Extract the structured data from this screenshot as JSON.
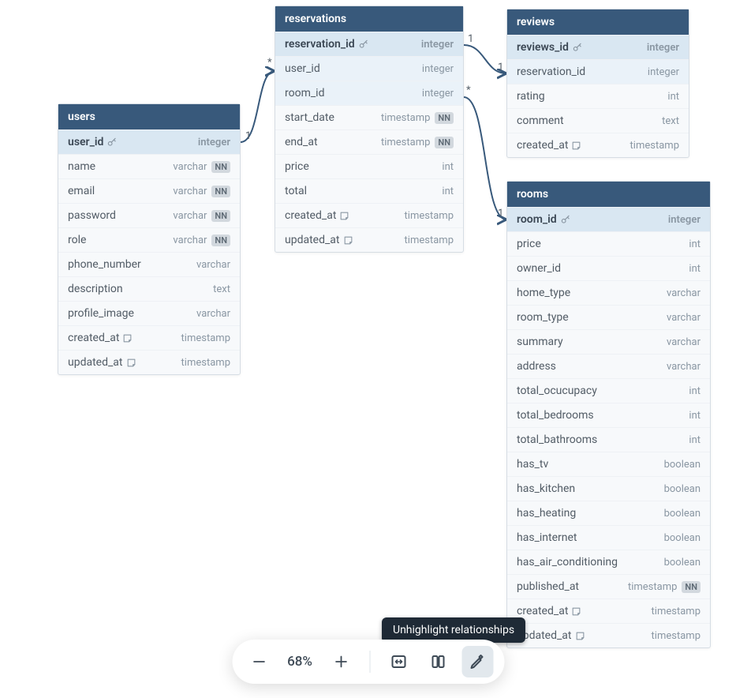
{
  "zoom": "68%",
  "tooltip": "Unhighlight relationships",
  "tables": {
    "users": {
      "title": "users",
      "rows": [
        {
          "name": "user_id",
          "type": "integer",
          "pk": true,
          "note": false,
          "nn": false,
          "hl": false
        },
        {
          "name": "name",
          "type": "varchar",
          "pk": false,
          "note": false,
          "nn": true,
          "hl": false
        },
        {
          "name": "email",
          "type": "varchar",
          "pk": false,
          "note": false,
          "nn": true,
          "hl": false
        },
        {
          "name": "password",
          "type": "varchar",
          "pk": false,
          "note": false,
          "nn": true,
          "hl": false
        },
        {
          "name": "role",
          "type": "varchar",
          "pk": false,
          "note": false,
          "nn": true,
          "hl": false
        },
        {
          "name": "phone_number",
          "type": "varchar",
          "pk": false,
          "note": false,
          "nn": false,
          "hl": false
        },
        {
          "name": "description",
          "type": "text",
          "pk": false,
          "note": false,
          "nn": false,
          "hl": false
        },
        {
          "name": "profile_image",
          "type": "varchar",
          "pk": false,
          "note": false,
          "nn": false,
          "hl": false
        },
        {
          "name": "created_at",
          "type": "timestamp",
          "pk": false,
          "note": true,
          "nn": false,
          "hl": false
        },
        {
          "name": "updated_at",
          "type": "timestamp",
          "pk": false,
          "note": true,
          "nn": false,
          "hl": false
        }
      ]
    },
    "reservations": {
      "title": "reservations",
      "rows": [
        {
          "name": "reservation_id",
          "type": "integer",
          "pk": true,
          "note": false,
          "nn": false,
          "hl": false
        },
        {
          "name": "user_id",
          "type": "integer",
          "pk": false,
          "note": false,
          "nn": false,
          "hl": true
        },
        {
          "name": "room_id",
          "type": "integer",
          "pk": false,
          "note": false,
          "nn": false,
          "hl": true
        },
        {
          "name": "start_date",
          "type": "timestamp",
          "pk": false,
          "note": false,
          "nn": true,
          "hl": false
        },
        {
          "name": "end_at",
          "type": "timestamp",
          "pk": false,
          "note": false,
          "nn": true,
          "hl": false
        },
        {
          "name": "price",
          "type": "int",
          "pk": false,
          "note": false,
          "nn": false,
          "hl": false
        },
        {
          "name": "total",
          "type": "int",
          "pk": false,
          "note": false,
          "nn": false,
          "hl": false
        },
        {
          "name": "created_at",
          "type": "timestamp",
          "pk": false,
          "note": true,
          "nn": false,
          "hl": false
        },
        {
          "name": "updated_at",
          "type": "timestamp",
          "pk": false,
          "note": true,
          "nn": false,
          "hl": false
        }
      ]
    },
    "reviews": {
      "title": "reviews",
      "rows": [
        {
          "name": "reviews_id",
          "type": "integer",
          "pk": true,
          "note": false,
          "nn": false,
          "hl": false
        },
        {
          "name": "reservation_id",
          "type": "integer",
          "pk": false,
          "note": false,
          "nn": false,
          "hl": true
        },
        {
          "name": "rating",
          "type": "int",
          "pk": false,
          "note": false,
          "nn": false,
          "hl": false
        },
        {
          "name": "comment",
          "type": "text",
          "pk": false,
          "note": false,
          "nn": false,
          "hl": false
        },
        {
          "name": "created_at",
          "type": "timestamp",
          "pk": false,
          "note": true,
          "nn": false,
          "hl": false
        }
      ]
    },
    "rooms": {
      "title": "rooms",
      "rows": [
        {
          "name": "room_id",
          "type": "integer",
          "pk": true,
          "note": false,
          "nn": false,
          "hl": false
        },
        {
          "name": "price",
          "type": "int",
          "pk": false,
          "note": false,
          "nn": false,
          "hl": false
        },
        {
          "name": "owner_id",
          "type": "int",
          "pk": false,
          "note": false,
          "nn": false,
          "hl": false
        },
        {
          "name": "home_type",
          "type": "varchar",
          "pk": false,
          "note": false,
          "nn": false,
          "hl": false
        },
        {
          "name": "room_type",
          "type": "varchar",
          "pk": false,
          "note": false,
          "nn": false,
          "hl": false
        },
        {
          "name": "summary",
          "type": "varchar",
          "pk": false,
          "note": false,
          "nn": false,
          "hl": false
        },
        {
          "name": "address",
          "type": "varchar",
          "pk": false,
          "note": false,
          "nn": false,
          "hl": false
        },
        {
          "name": "total_ocucupacy",
          "type": "int",
          "pk": false,
          "note": false,
          "nn": false,
          "hl": false
        },
        {
          "name": "total_bedrooms",
          "type": "int",
          "pk": false,
          "note": false,
          "nn": false,
          "hl": false
        },
        {
          "name": "total_bathrooms",
          "type": "int",
          "pk": false,
          "note": false,
          "nn": false,
          "hl": false
        },
        {
          "name": "has_tv",
          "type": "boolean",
          "pk": false,
          "note": false,
          "nn": false,
          "hl": false
        },
        {
          "name": "has_kitchen",
          "type": "boolean",
          "pk": false,
          "note": false,
          "nn": false,
          "hl": false
        },
        {
          "name": "has_heating",
          "type": "boolean",
          "pk": false,
          "note": false,
          "nn": false,
          "hl": false
        },
        {
          "name": "has_internet",
          "type": "boolean",
          "pk": false,
          "note": false,
          "nn": false,
          "hl": false
        },
        {
          "name": "has_air_conditioning",
          "type": "boolean",
          "pk": false,
          "note": false,
          "nn": false,
          "hl": false
        },
        {
          "name": "published_at",
          "type": "timestamp",
          "pk": false,
          "note": false,
          "nn": true,
          "hl": false
        },
        {
          "name": "created_at",
          "type": "timestamp",
          "pk": false,
          "note": true,
          "nn": false,
          "hl": false
        },
        {
          "name": "updated_at",
          "type": "timestamp",
          "pk": false,
          "note": true,
          "nn": false,
          "hl": false
        }
      ]
    }
  },
  "cardinalities": {
    "users_pk": "1",
    "res_user": "*",
    "res_pk_rev": "1",
    "rev_res": "1",
    "res_room": "*",
    "rooms_pk": "1"
  }
}
